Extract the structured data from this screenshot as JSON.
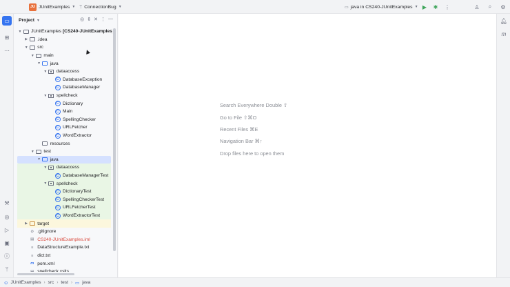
{
  "titlebar": {
    "project_badge": "JU",
    "project_name": "JUnitExamples",
    "branch": "ConnectionBug",
    "run_config": "java in CS240-JUnitExamples"
  },
  "panel": {
    "title": "Project"
  },
  "tree": [
    {
      "label": "JUnitExamples",
      "suffix": "[CS240-JUnitExamples]",
      "depth": 0,
      "arrow": "open",
      "icon": "folder"
    },
    {
      "label": ".idea",
      "depth": 1,
      "arrow": "closed",
      "icon": "folder"
    },
    {
      "label": "src",
      "depth": 1,
      "arrow": "open",
      "icon": "folder"
    },
    {
      "label": "main",
      "depth": 2,
      "arrow": "open",
      "icon": "folder"
    },
    {
      "label": "java",
      "depth": 3,
      "arrow": "open",
      "icon": "folder-blue"
    },
    {
      "label": "dataaccess",
      "depth": 4,
      "arrow": "open",
      "icon": "package"
    },
    {
      "label": "DatabaseException",
      "depth": 5,
      "arrow": "none",
      "icon": "class"
    },
    {
      "label": "DatabaseManager",
      "depth": 5,
      "arrow": "none",
      "icon": "class"
    },
    {
      "label": "spellcheck",
      "depth": 4,
      "arrow": "open",
      "icon": "package"
    },
    {
      "label": "Dictionary",
      "depth": 5,
      "arrow": "none",
      "icon": "class"
    },
    {
      "label": "Main",
      "depth": 5,
      "arrow": "none",
      "icon": "class"
    },
    {
      "label": "SpellingChecker",
      "depth": 5,
      "arrow": "none",
      "icon": "class"
    },
    {
      "label": "URLFetcher",
      "depth": 5,
      "arrow": "none",
      "icon": "class"
    },
    {
      "label": "WordExtractor",
      "depth": 5,
      "arrow": "none",
      "icon": "class"
    },
    {
      "label": "resources",
      "depth": 3,
      "arrow": "none",
      "icon": "folder"
    },
    {
      "label": "test",
      "depth": 2,
      "arrow": "open",
      "icon": "folder"
    },
    {
      "label": "java",
      "depth": 3,
      "arrow": "open",
      "icon": "folder-blue",
      "state": "selected"
    },
    {
      "label": "dataaccess",
      "depth": 4,
      "arrow": "open",
      "icon": "package",
      "state": "green"
    },
    {
      "label": "DatabaseManagerTest",
      "depth": 5,
      "arrow": "none",
      "icon": "class",
      "state": "green"
    },
    {
      "label": "spellcheck",
      "depth": 4,
      "arrow": "open",
      "icon": "package",
      "state": "green"
    },
    {
      "label": "DictionaryTest",
      "depth": 5,
      "arrow": "none",
      "icon": "class",
      "state": "green"
    },
    {
      "label": "SpellingCheckerTest",
      "depth": 5,
      "arrow": "none",
      "icon": "class",
      "state": "green"
    },
    {
      "label": "URLFetcherTest",
      "depth": 5,
      "arrow": "none",
      "icon": "class",
      "state": "green"
    },
    {
      "label": "WordExtractorTest",
      "depth": 5,
      "arrow": "none",
      "icon": "class",
      "state": "green"
    },
    {
      "label": "target",
      "depth": 1,
      "arrow": "closed",
      "icon": "folder-orange",
      "state": "yellow"
    },
    {
      "label": ".gitignore",
      "depth": 1,
      "arrow": "none",
      "icon": "ignore"
    },
    {
      "label": "CS240-JUnitExamples.iml",
      "depth": 1,
      "arrow": "none",
      "icon": "file",
      "color": "red"
    },
    {
      "label": "DataStructureExample.txt",
      "depth": 1,
      "arrow": "none",
      "icon": "text"
    },
    {
      "label": "dict.txt",
      "depth": 1,
      "arrow": "none",
      "icon": "text"
    },
    {
      "label": "pom.xml",
      "depth": 1,
      "arrow": "none",
      "icon": "maven"
    },
    {
      "label": "spellcheck.xslts",
      "depth": 1,
      "arrow": "none",
      "icon": "file"
    }
  ],
  "editor": {
    "hints": [
      "Search Everywhere Double ⇧",
      "Go to File ⇧⌘O",
      "Recent Files ⌘E",
      "Navigation Bar ⌘↑",
      "Drop files here to open them"
    ]
  },
  "statusbar": {
    "crumbs": [
      "JUnitExamples",
      "src",
      "test",
      "java"
    ]
  }
}
